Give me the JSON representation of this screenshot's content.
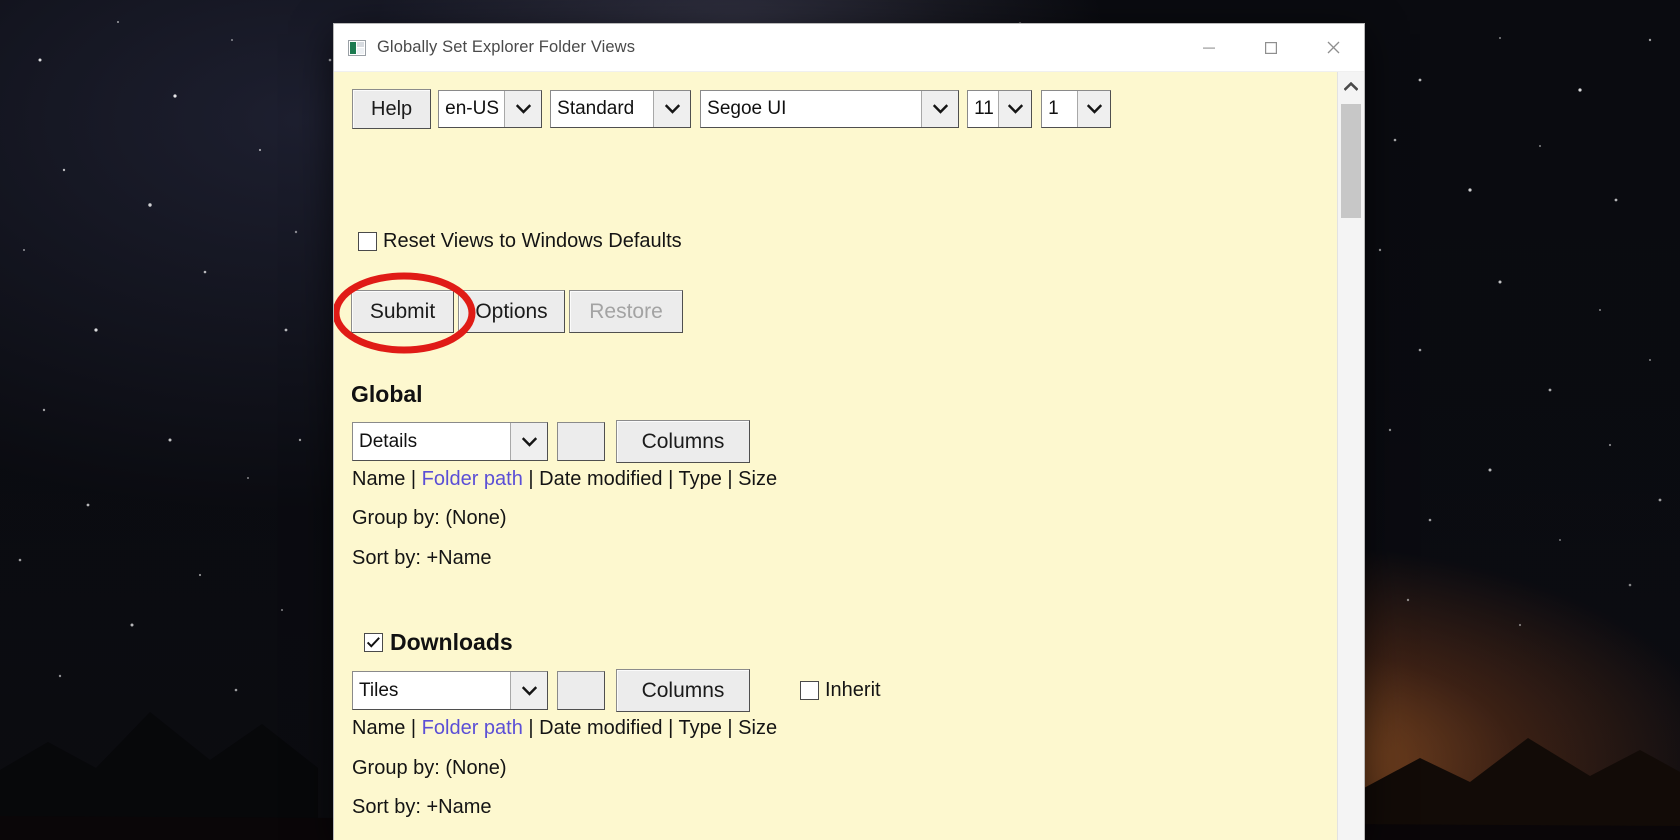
{
  "window": {
    "title": "Globally Set Explorer Folder Views",
    "icon": "app-window-icon",
    "controls": {
      "minimize": "minimize-icon",
      "maximize": "maximize-icon",
      "close": "close-icon"
    }
  },
  "toolbar": {
    "help_label": "Help",
    "language": {
      "value": "en-US"
    },
    "profile": {
      "value": "Standard"
    },
    "font_family": {
      "value": "Segoe UI"
    },
    "font_size": {
      "value": "11"
    },
    "scale": {
      "value": "1"
    }
  },
  "reset_checkbox": {
    "label": "Reset Views to Windows Defaults",
    "checked": false
  },
  "actions": {
    "submit": "Submit",
    "options": "Options",
    "restore": "Restore",
    "restore_disabled": true
  },
  "annotation": {
    "shape": "ellipse",
    "color": "#e01b16",
    "targets": "Submit"
  },
  "sections": [
    {
      "id": "global",
      "heading": "Global",
      "has_checkbox": false,
      "checked": false,
      "view_mode": "Details",
      "columns_label": "Columns",
      "has_inherit": false,
      "inherit_label": "",
      "inherit_checked": false,
      "columns_prefix": "Name | ",
      "columns_accent": "Folder path",
      "columns_suffix": " | Date modified | Type | Size",
      "group_by": "Group by: (None)",
      "sort_by": "Sort by: +Name"
    },
    {
      "id": "downloads",
      "heading": "Downloads",
      "has_checkbox": true,
      "checked": true,
      "view_mode": "Tiles",
      "columns_label": "Columns",
      "has_inherit": true,
      "inherit_label": "Inherit",
      "inherit_checked": false,
      "columns_prefix": "Name | ",
      "columns_accent": "Folder path",
      "columns_suffix": " | Date modified | Type | Size",
      "group_by": "Group by: (None)",
      "sort_by": "Sort by: +Name"
    }
  ],
  "colors": {
    "window_bg": "#fdf8cf",
    "accent_link": "#5b4fd6",
    "annotation": "#e01b16",
    "titlebar": "#ffffff"
  }
}
